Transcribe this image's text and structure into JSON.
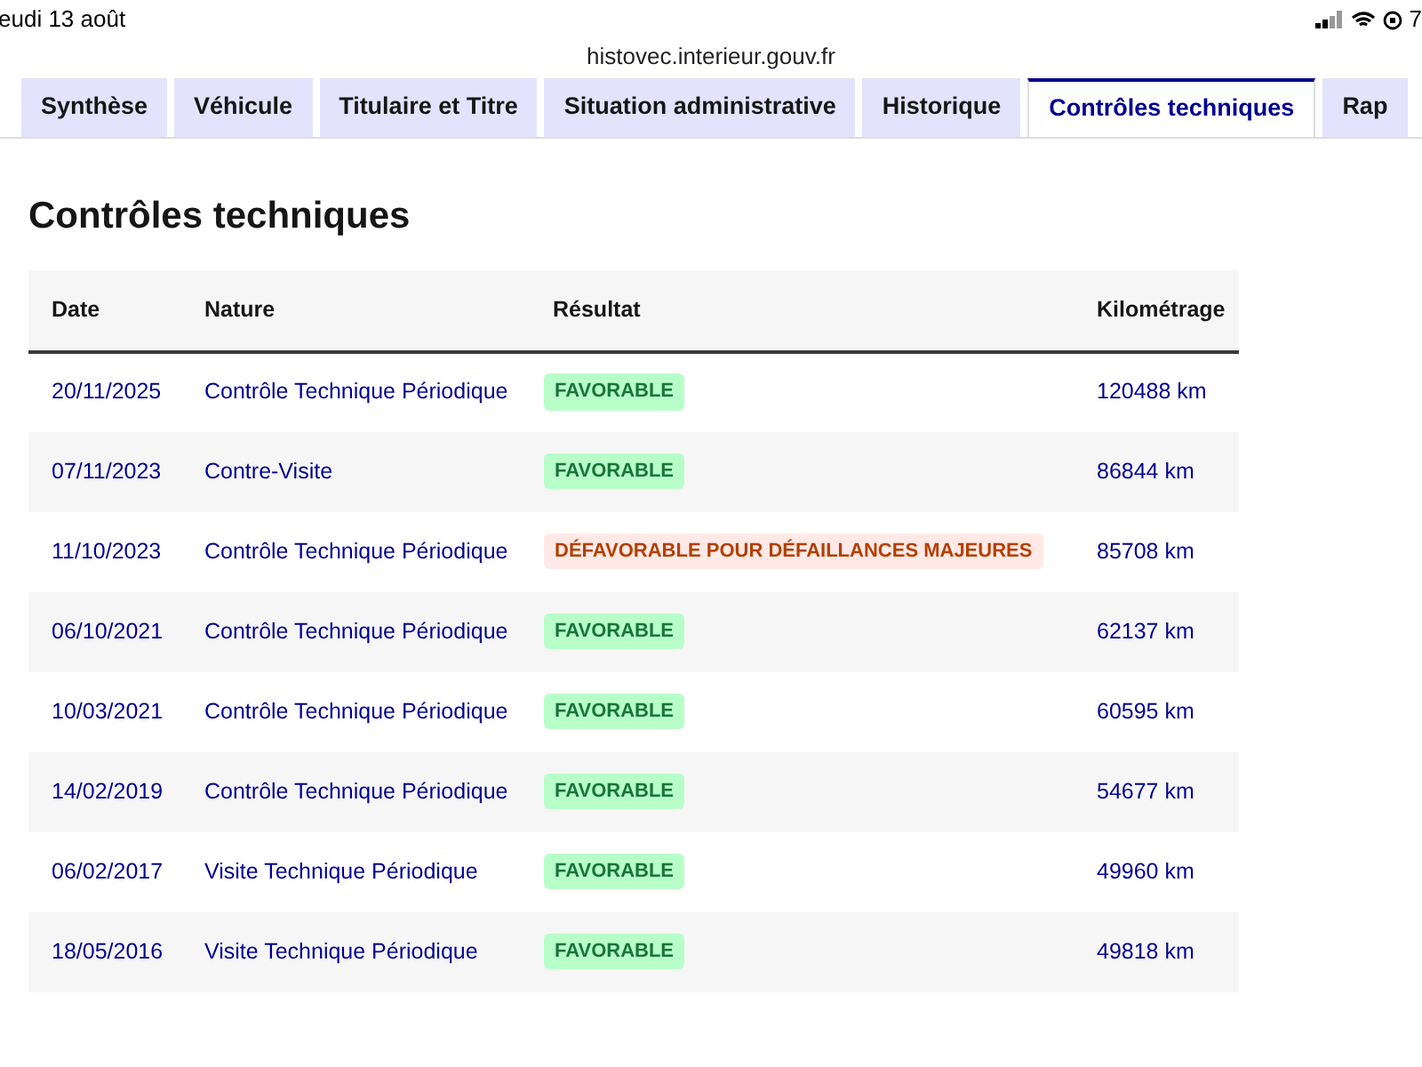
{
  "status_bar": {
    "date": "eudi 13 août",
    "time": "7"
  },
  "address_bar": {
    "url": "histovec.interieur.gouv.fr"
  },
  "tabs": [
    {
      "label": "Synthèse",
      "selected": false
    },
    {
      "label": "Véhicule",
      "selected": false
    },
    {
      "label": "Titulaire et Titre",
      "selected": false
    },
    {
      "label": "Situation administrative",
      "selected": false
    },
    {
      "label": "Historique",
      "selected": false
    },
    {
      "label": "Contrôles techniques",
      "selected": true
    },
    {
      "label": "Rap",
      "selected": false
    }
  ],
  "section_title": "Contrôles techniques",
  "table": {
    "columns": [
      "Date",
      "Nature",
      "Résultat",
      "Kilométrage"
    ],
    "rows": [
      {
        "date": "20/11/2025",
        "nature": "Contrôle Technique Périodique",
        "result": {
          "kind": "favorable",
          "label": "FAVORABLE"
        },
        "mileage": "120488 km"
      },
      {
        "date": "07/11/2023",
        "nature": "Contre-Visite",
        "result": {
          "kind": "favorable",
          "label": "FAVORABLE"
        },
        "mileage": "86844 km"
      },
      {
        "date": "11/10/2023",
        "nature": "Contrôle Technique Périodique",
        "result": {
          "kind": "unfavorable",
          "label": "DÉFAVORABLE POUR DÉFAILLANCES MAJEURES"
        },
        "mileage": "85708 km"
      },
      {
        "date": "06/10/2021",
        "nature": "Contrôle Technique Périodique",
        "result": {
          "kind": "favorable",
          "label": "FAVORABLE"
        },
        "mileage": "62137 km"
      },
      {
        "date": "10/03/2021",
        "nature": "Contrôle Technique Périodique",
        "result": {
          "kind": "favorable",
          "label": "FAVORABLE"
        },
        "mileage": "60595 km"
      },
      {
        "date": "14/02/2019",
        "nature": "Contrôle Technique Périodique",
        "result": {
          "kind": "favorable",
          "label": "FAVORABLE"
        },
        "mileage": "54677 km"
      },
      {
        "date": "06/02/2017",
        "nature": "Visite Technique Périodique",
        "result": {
          "kind": "favorable",
          "label": "FAVORABLE"
        },
        "mileage": "49960 km"
      },
      {
        "date": "18/05/2016",
        "nature": "Visite Technique Périodique",
        "result": {
          "kind": "favorable",
          "label": "FAVORABLE"
        },
        "mileage": "49818 km"
      }
    ]
  }
}
